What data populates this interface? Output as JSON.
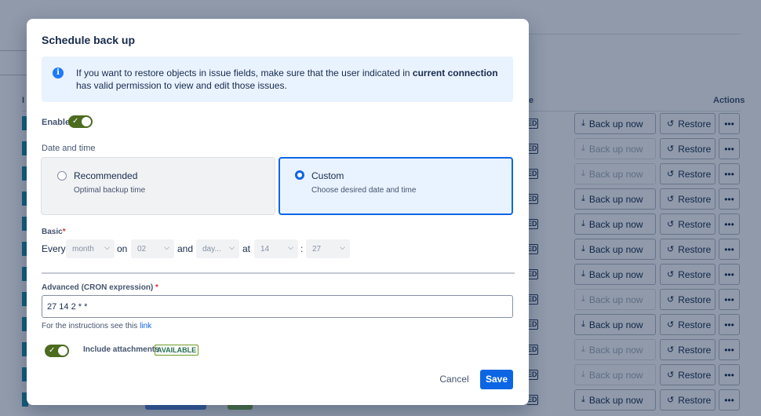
{
  "background": {
    "columns": {
      "status": "e",
      "actions": "Actions",
      "first": "I"
    },
    "status_fragment": "ED",
    "backup_label": "Back up now",
    "restore_label": "Restore",
    "more_label": "•••",
    "rows": [
      {
        "backup_enabled": true
      },
      {
        "backup_enabled": false
      },
      {
        "backup_enabled": false
      },
      {
        "backup_enabled": true
      },
      {
        "backup_enabled": true
      },
      {
        "backup_enabled": true
      },
      {
        "backup_enabled": true
      },
      {
        "backup_enabled": false
      },
      {
        "backup_enabled": true
      },
      {
        "backup_enabled": false
      },
      {
        "backup_enabled": false
      },
      {
        "backup_enabled": true
      }
    ]
  },
  "modal": {
    "title": "Schedule back up",
    "info": {
      "text_before": "If you want to restore objects in issue fields, make sure that the user indicated in ",
      "bold": "current connection",
      "text_after": " has valid permission to view and edit those issues."
    },
    "enable_label": "Enable",
    "enable_on": true,
    "date_time_label": "Date and time",
    "options": [
      {
        "title": "Recommended",
        "subtitle": "Optimal backup time",
        "selected": false
      },
      {
        "title": "Custom",
        "subtitle": "Choose desired date and time",
        "selected": true
      }
    ],
    "basic": {
      "label": "Basic",
      "required_mark": "*",
      "every_word": "Every",
      "on_word": "on",
      "and_word": "and",
      "at_word": "at",
      "colon": ":",
      "period_value": "month",
      "date_value": "02",
      "day_value": "day...",
      "hour_value": "14",
      "minute_value": "27"
    },
    "advanced": {
      "label": "Advanced (CRON expression)",
      "required_mark": "*",
      "value": "27 14 2 * *"
    },
    "helper_text": "For the instructions see this ",
    "helper_link": "link",
    "attachments_label": "Include attachments",
    "attachments_badge": "AVAILABLE",
    "attachments_on": true,
    "cancel_label": "Cancel",
    "save_label": "Save",
    "colors": {
      "primary": "#0c66e4",
      "toggle": "#4c6b1f",
      "info_bg": "#e9f2ff"
    }
  }
}
